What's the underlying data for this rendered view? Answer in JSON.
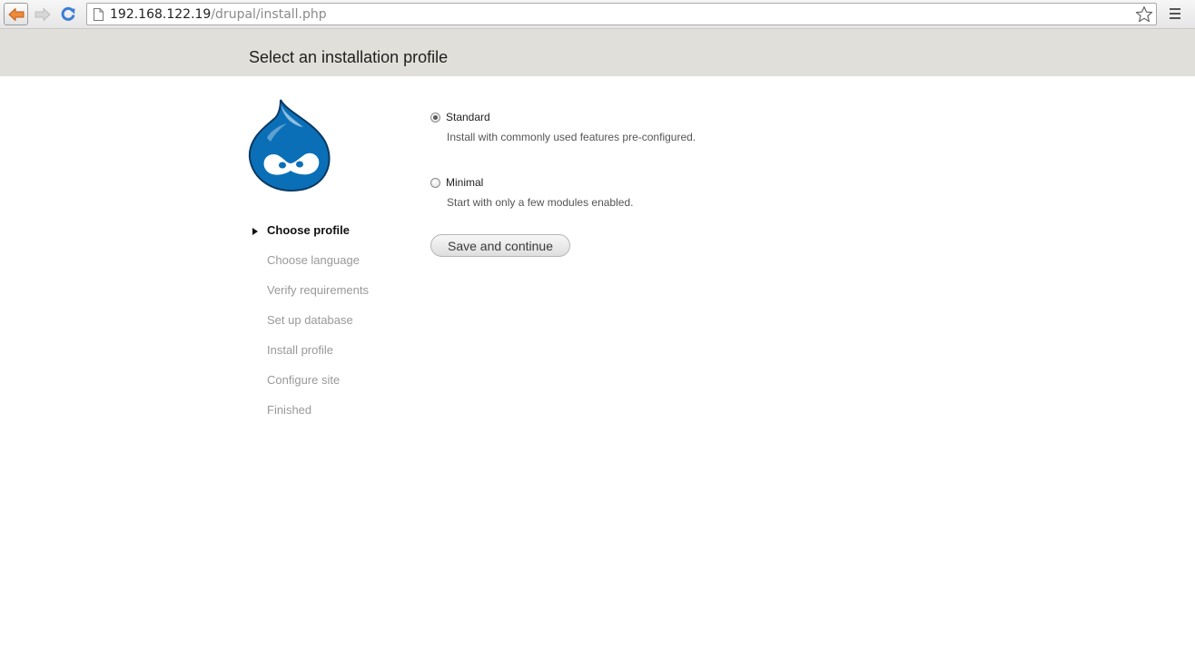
{
  "browser": {
    "url_host": "192.168.122.19",
    "url_path": "/drupal/install.php",
    "icons": {
      "back": "back-arrow-icon",
      "forward": "forward-arrow-icon",
      "reload": "reload-icon",
      "page": "page-icon",
      "bookmark": "star-icon",
      "menu": "hamburger-menu-icon"
    },
    "colors": {
      "back_arrow": "#e8742a",
      "reload": "#3b7dd8"
    }
  },
  "header": {
    "title": "Select an installation profile",
    "background": "#e0dfd9"
  },
  "sidebar": {
    "logo": "drupal-drop-logo",
    "logo_color": "#0077c0",
    "tasks": [
      {
        "label": "Choose profile",
        "active": true
      },
      {
        "label": "Choose language",
        "active": false
      },
      {
        "label": "Verify requirements",
        "active": false
      },
      {
        "label": "Set up database",
        "active": false
      },
      {
        "label": "Install profile",
        "active": false
      },
      {
        "label": "Configure site",
        "active": false
      },
      {
        "label": "Finished",
        "active": false
      }
    ]
  },
  "form": {
    "options": [
      {
        "label": "Standard",
        "description": "Install with commonly used features pre-configured.",
        "selected": true
      },
      {
        "label": "Minimal",
        "description": "Start with only a few modules enabled.",
        "selected": false
      }
    ],
    "submit_label": "Save and continue"
  }
}
